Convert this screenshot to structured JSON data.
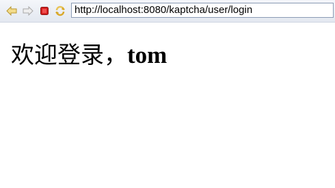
{
  "browser": {
    "url": "http://localhost:8080/kaptcha/user/login",
    "icons": [
      "back-arrow-icon",
      "forward-arrow-icon",
      "stop-icon",
      "refresh-icon"
    ],
    "colors": {
      "arrow": "#e8c45a",
      "stop": "#d42020",
      "toolbar": "#e8edf4"
    }
  },
  "page": {
    "greeting": "欢迎登录，",
    "username": "tom"
  }
}
